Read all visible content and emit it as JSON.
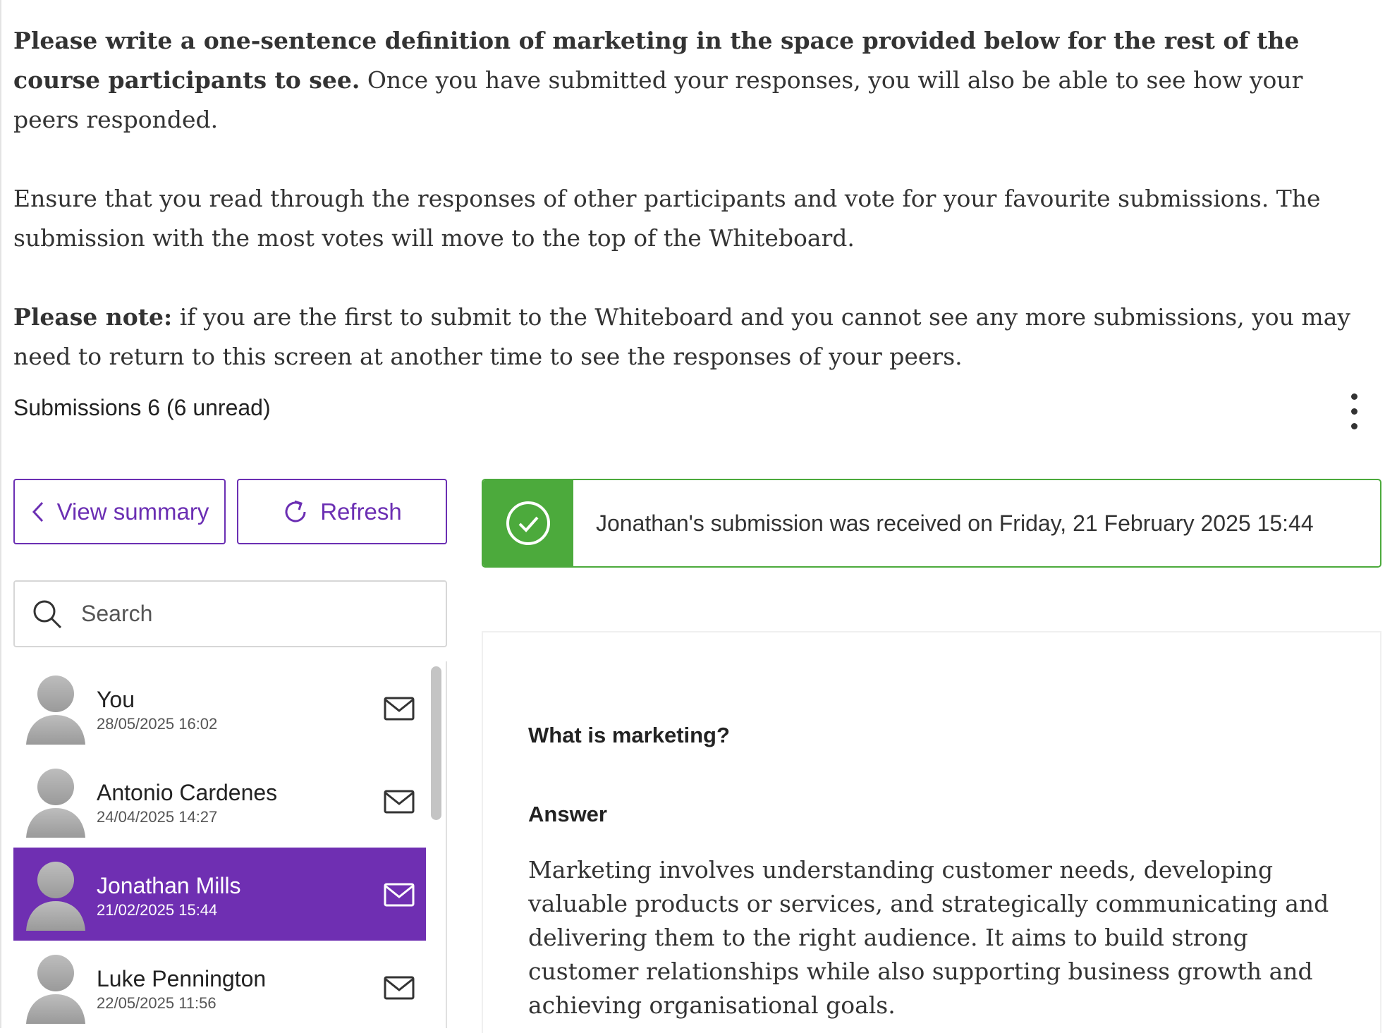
{
  "intro": {
    "p1_bold": "Please write a one-sentence definition of marketing in the space provided below for the rest of the course participants to see.",
    "p1_rest": " Once you have submitted your responses, you will also be able to see how your peers responded.",
    "p2": "Ensure that you read through the responses of other participants and vote for your favourite submissions. The submission with the most votes will move to the top of the Whiteboard.",
    "p3_bold": "Please note:",
    "p3_rest": " if you are the first to submit to the Whiteboard and you cannot see any more submissions, you may need to return to this screen at another time to see the responses of your peers."
  },
  "submissions": {
    "count_label": "Submissions 6 (6 unread)"
  },
  "buttons": {
    "view_summary": "View summary",
    "refresh": "Refresh"
  },
  "search": {
    "placeholder": "Search",
    "value": ""
  },
  "list": [
    {
      "name": "You",
      "date": "28/05/2025 16:02",
      "selected": false
    },
    {
      "name": "Antonio Cardenes",
      "date": "24/04/2025 14:27",
      "selected": false
    },
    {
      "name": "Jonathan Mills",
      "date": "21/02/2025 15:44",
      "selected": true
    },
    {
      "name": "Luke Pennington",
      "date": "22/05/2025 11:56",
      "selected": false
    }
  ],
  "notice": {
    "message": "Jonathan's submission was received on Friday, 21 February 2025 15:44"
  },
  "detail": {
    "question": "What is marketing?",
    "answer_label": "Answer",
    "answer_text": "Marketing involves understanding customer needs, developing valuable products or services, and strategically communicating and delivering them to the right audience. It aims to build strong customer relationships while also supporting business growth and achieving organisational goals."
  },
  "colors": {
    "accent": "#6f2fb2",
    "success": "#4caa3c"
  },
  "icons": [
    "chevron-left-icon",
    "refresh-icon",
    "search-icon",
    "avatar-icon",
    "envelope-icon",
    "check-circle-icon",
    "more-vertical-icon"
  ]
}
